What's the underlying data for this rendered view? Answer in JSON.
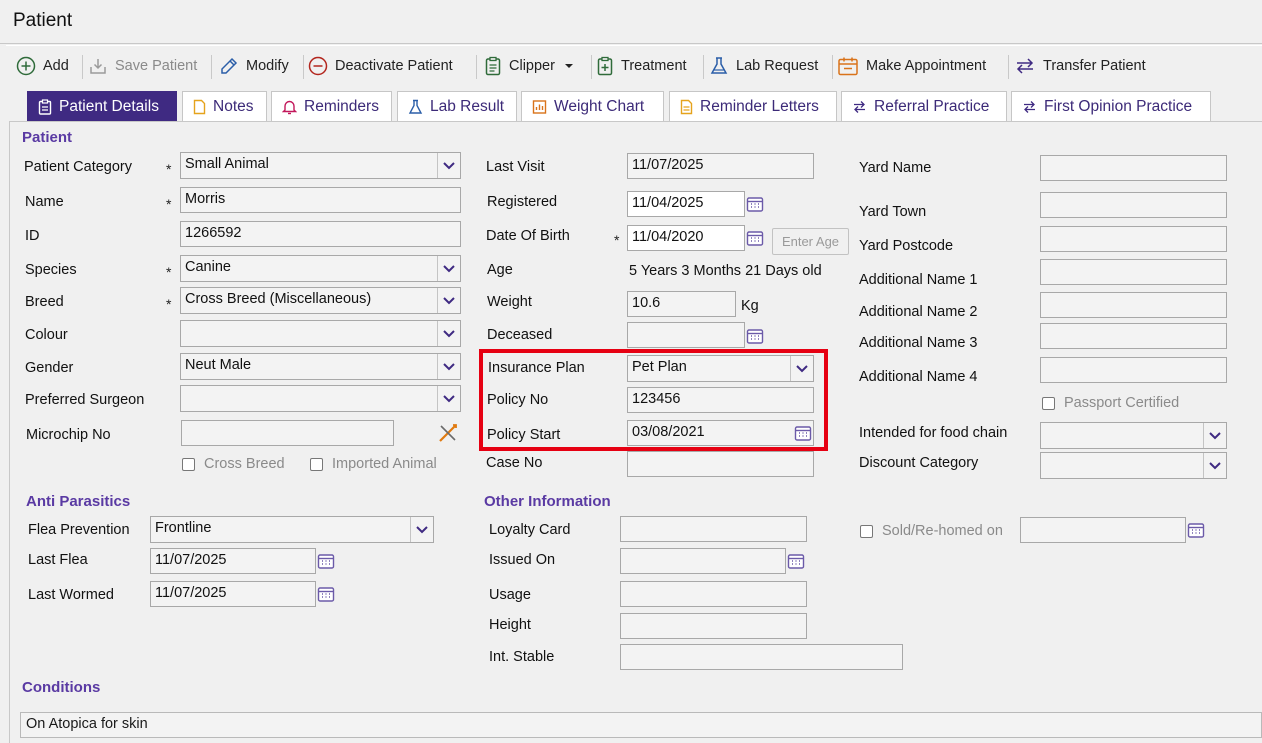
{
  "window": {
    "title": "Patient"
  },
  "toolbar": {
    "add": "Add",
    "save": "Save Patient",
    "modify": "Modify",
    "deactivate": "Deactivate Patient",
    "clipper": "Clipper",
    "treatment": "Treatment",
    "lab_request": "Lab Request",
    "make_appointment": "Make Appointment",
    "transfer": "Transfer Patient"
  },
  "tabs": [
    "Patient Details",
    "Notes",
    "Reminders",
    "Lab Result",
    "Weight Chart",
    "Reminder Letters",
    "Referral Practice",
    "First Opinion Practice"
  ],
  "patient": {
    "section": "Patient",
    "labels": {
      "category": "Patient Category",
      "name": "Name",
      "id": "ID",
      "species": "Species",
      "breed": "Breed",
      "colour": "Colour",
      "gender": "Gender",
      "surgeon": "Preferred Surgeon",
      "microchip": "Microchip No"
    },
    "values": {
      "category": "Small Animal",
      "name": "Morris",
      "id": "1266592",
      "species": "Canine",
      "breed": "Cross Breed (Miscellaneous)",
      "colour": "",
      "gender": "Neut Male",
      "surgeon": "",
      "microchip": ""
    },
    "required_mark": "*",
    "cross_breed": "Cross Breed",
    "imported_animal": "Imported Animal"
  },
  "visit": {
    "labels": {
      "last_visit": "Last Visit",
      "registered": "Registered",
      "dob": "Date Of Birth",
      "age": "Age",
      "weight": "Weight",
      "deceased": "Deceased",
      "insurance_plan": "Insurance Plan",
      "policy_no": "Policy No",
      "policy_start": "Policy Start",
      "case_no": "Case No"
    },
    "values": {
      "last_visit": "11/07/2025",
      "registered": "11/04/2025",
      "dob": "11/04/2020",
      "age": "5 Years 3 Months 21 Days old",
      "weight": "10.6",
      "weight_unit": "Kg",
      "deceased": "",
      "insurance_plan": "Pet Plan",
      "policy_no": "123456",
      "policy_start": "03/08/2021",
      "case_no": ""
    },
    "enter_age": "Enter Age"
  },
  "yard": {
    "labels": {
      "yard_name": "Yard Name",
      "yard_town": "Yard Town",
      "yard_postcode": "Yard Postcode",
      "add1": "Additional Name 1",
      "add2": "Additional Name 2",
      "add3": "Additional Name 3",
      "add4": "Additional Name 4",
      "food_chain": "Intended for food chain",
      "discount": "Discount Category"
    },
    "passport": "Passport Certified"
  },
  "anti_parasitics": {
    "section": "Anti Parasitics",
    "labels": {
      "flea_prevention": "Flea Prevention",
      "last_flea": "Last Flea",
      "last_wormed": "Last Wormed"
    },
    "values": {
      "flea_prevention": "Frontline",
      "last_flea": "11/07/2025",
      "last_wormed": "11/07/2025"
    }
  },
  "other": {
    "section": "Other Information",
    "labels": {
      "loyalty": "Loyalty Card",
      "issued": "Issued On",
      "usage": "Usage",
      "height": "Height",
      "int_stable": "Int. Stable"
    },
    "sold": "Sold/Re-homed on"
  },
  "conditions": {
    "section": "Conditions",
    "text": "On Atopica for skin"
  },
  "colors": {
    "accent": "#3f2a82",
    "section_text": "#5a3aa3",
    "highlight": "#e60012"
  }
}
